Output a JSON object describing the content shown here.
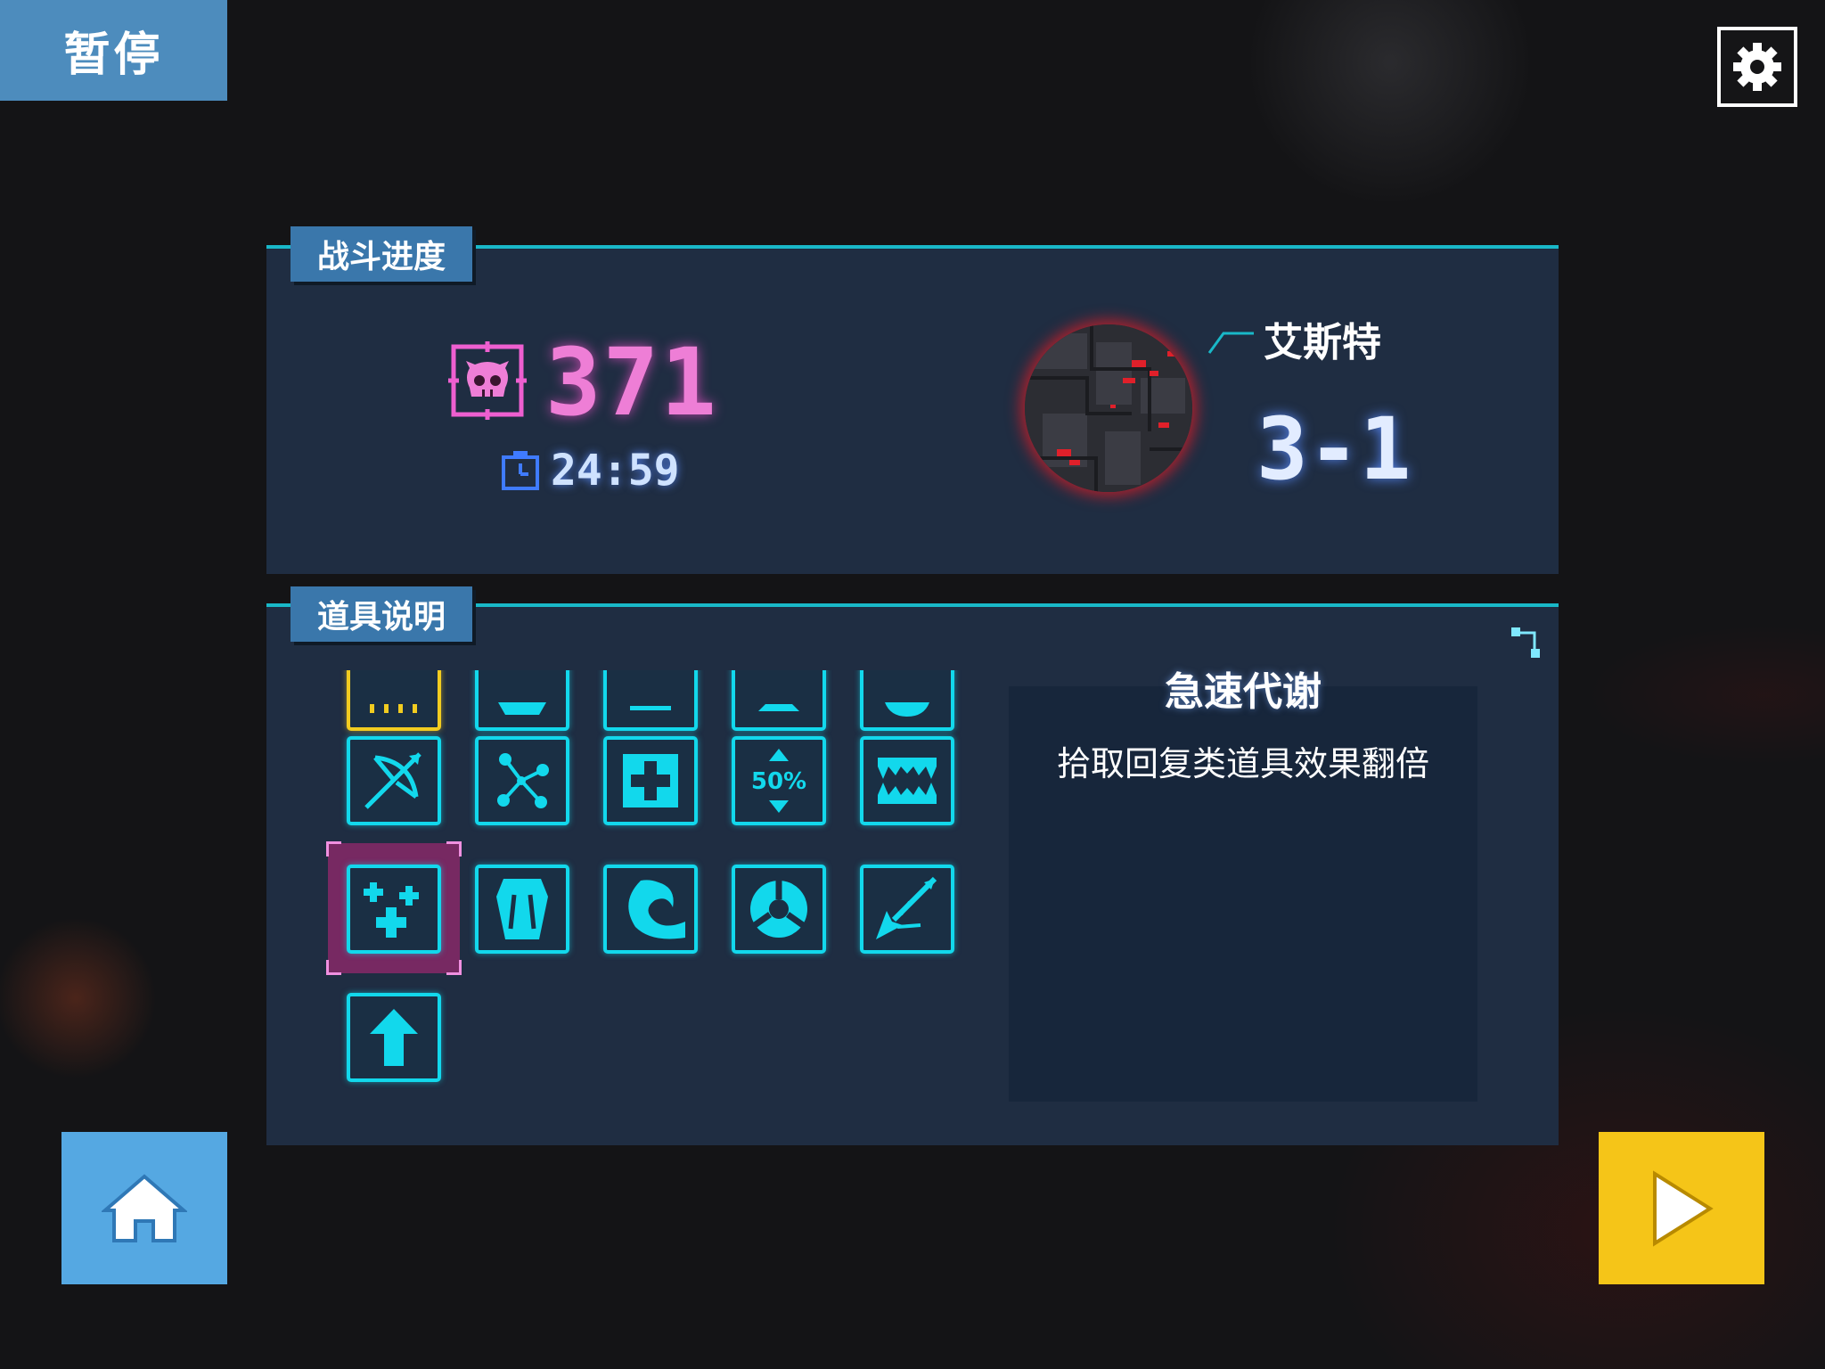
{
  "header": {
    "pause_label": "暂停",
    "settings_icon": "gear-icon"
  },
  "battle_progress": {
    "title": "战斗进度",
    "kill_count": "371",
    "time": "24:59",
    "stage_name": "艾斯特",
    "stage_level": "3-1"
  },
  "item_info": {
    "title": "道具说明",
    "items": [
      "item-gold-partial",
      "item-partial-2",
      "item-partial-3",
      "item-partial-4",
      "item-partial-5",
      "crossbow-icon",
      "network-nodes-icon",
      "medkit-icon",
      "fifty-percent-icon",
      "fangs-icon",
      "sparkle-cross-icon",
      "coffin-icon",
      "wave-icon",
      "shield-ring-icon",
      "arrow-burst-icon",
      "upgrade-arrow-icon"
    ],
    "selected_item_name": "急速代谢",
    "selected_item_desc": "拾取回复类道具效果翻倍",
    "fifty_label": "50%"
  },
  "colors": {
    "panel_bg": "#1f2d42",
    "accent_cyan": "#12d8ec",
    "kill_pink": "#ee7ed6",
    "home_blue": "#55a8e2",
    "play_yellow": "#f5c518"
  },
  "footer": {
    "home_icon": "home-icon",
    "play_icon": "play-icon"
  }
}
